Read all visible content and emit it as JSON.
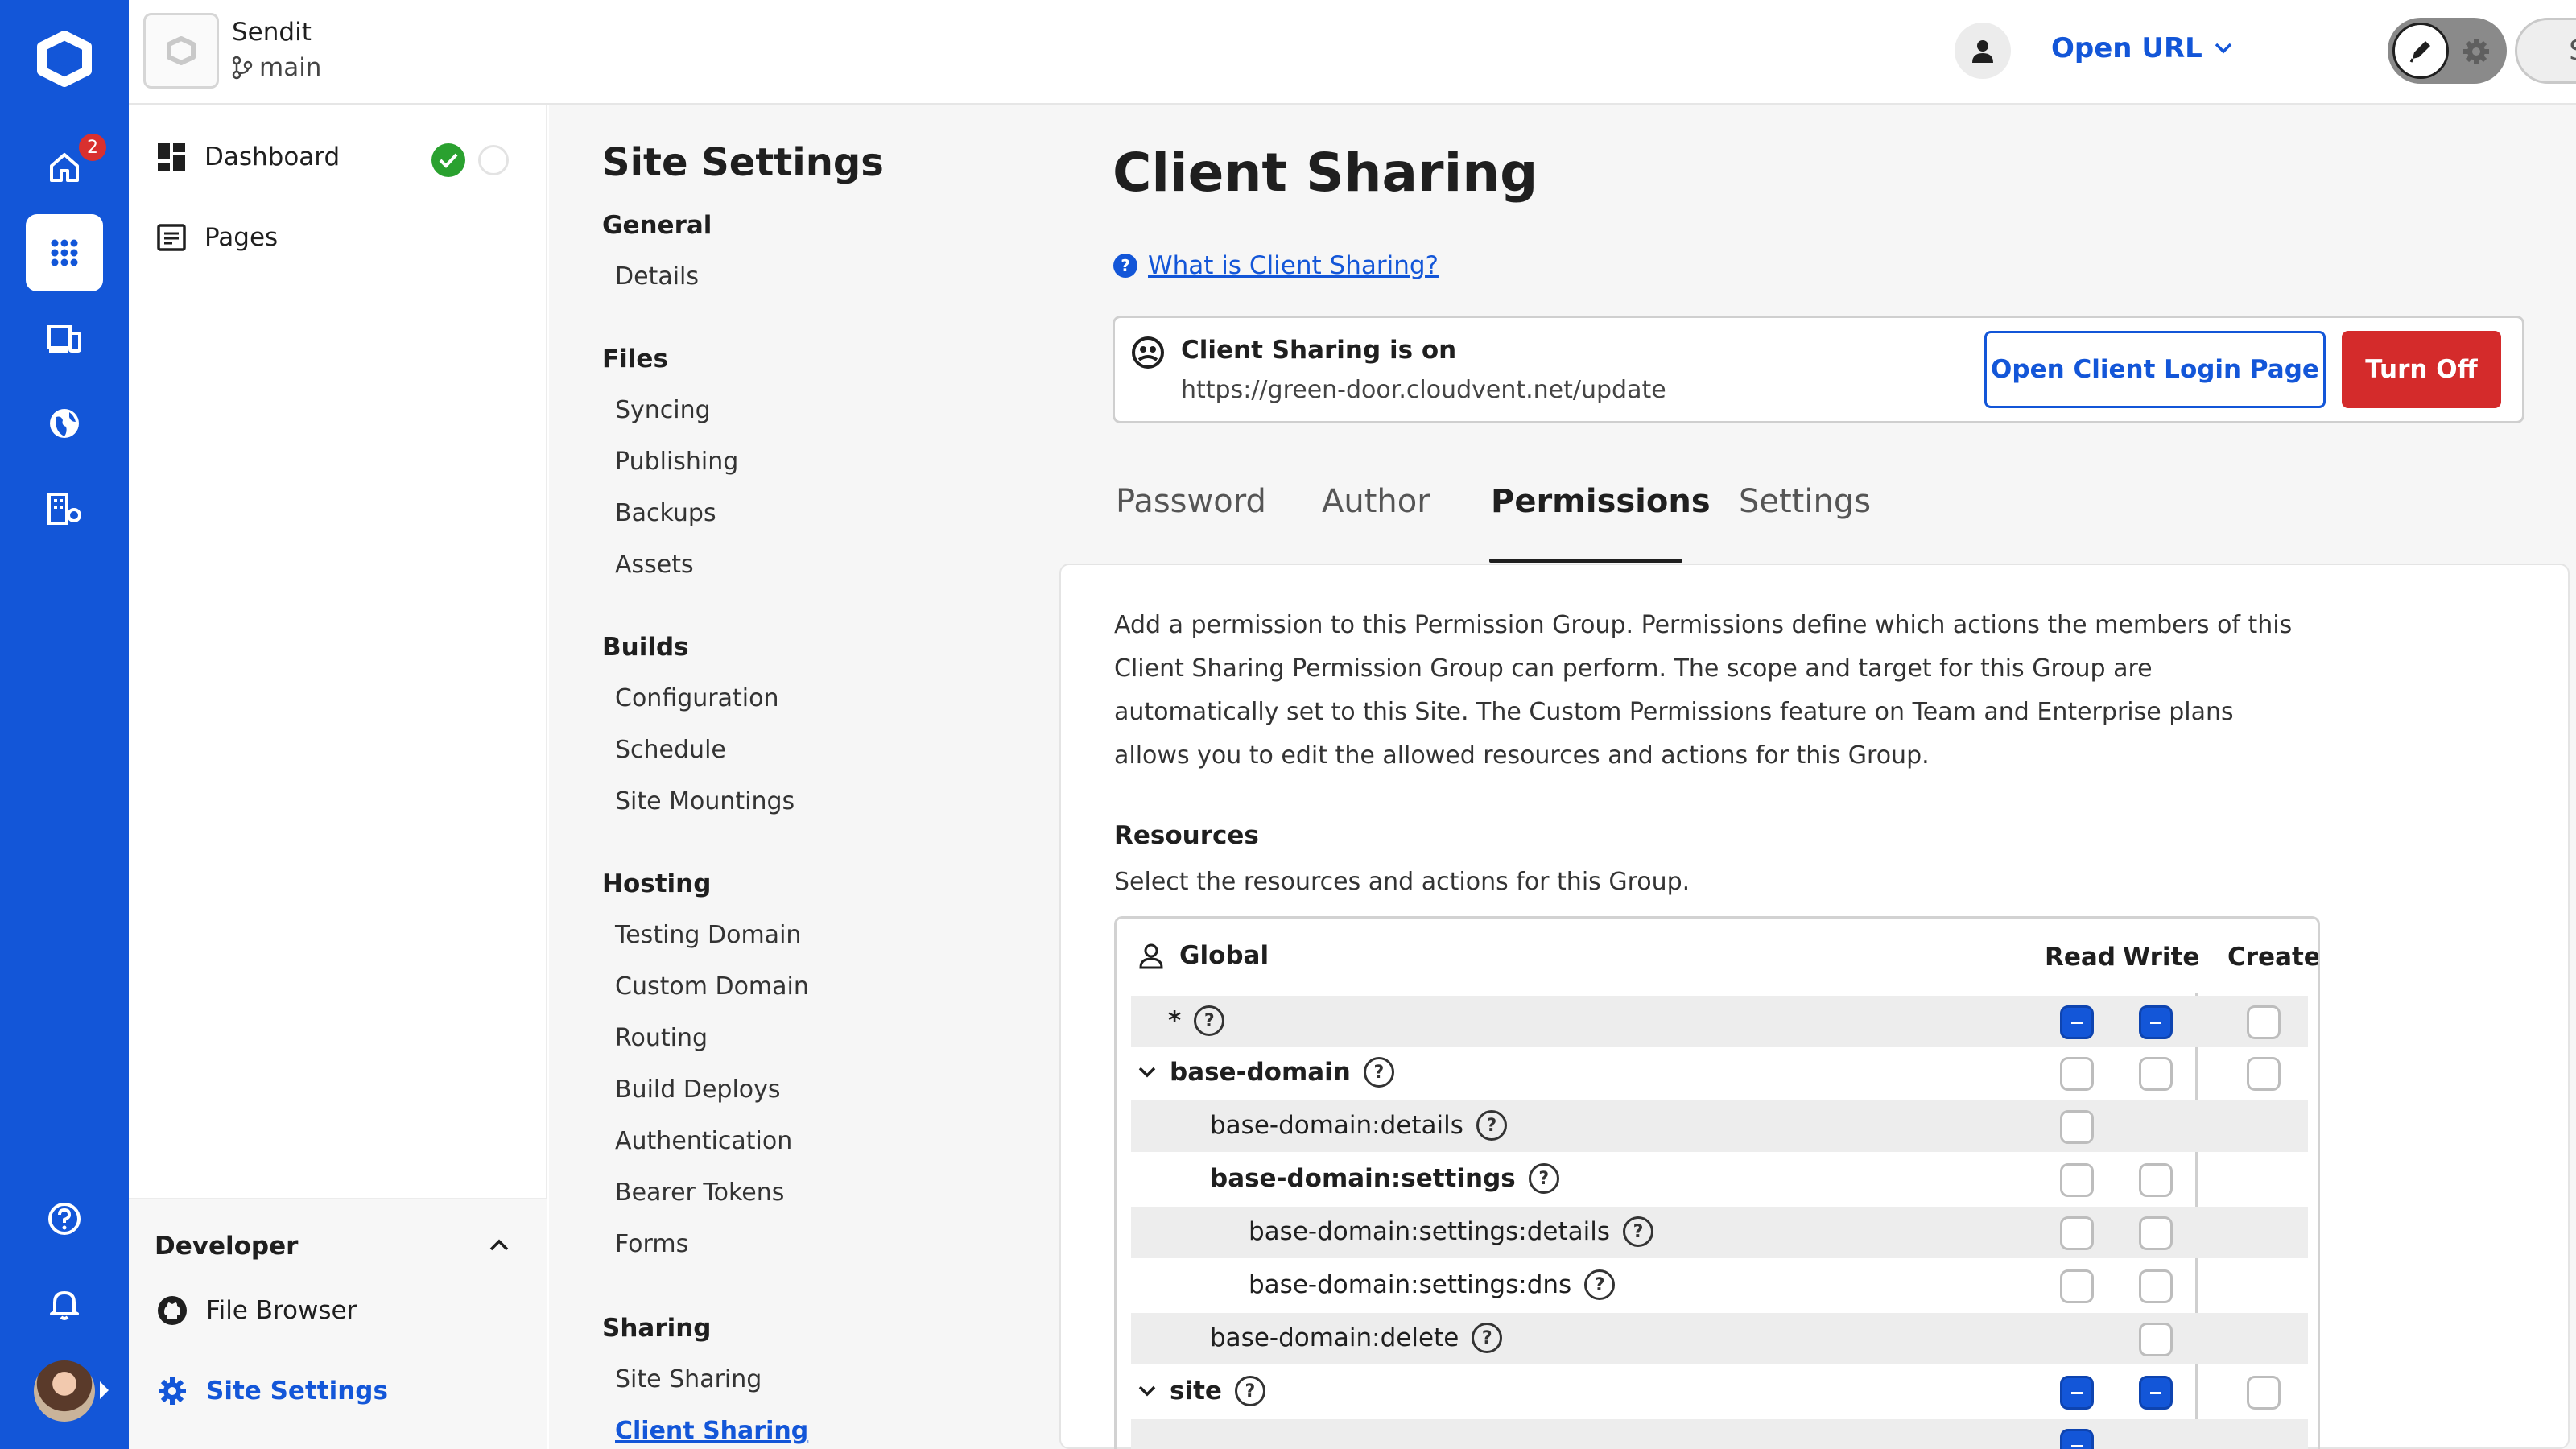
{
  "header": {
    "site_name": "Sendit",
    "branch": "main",
    "open_url": "Open URL",
    "save": "Save"
  },
  "rail": {
    "notification_count": "2"
  },
  "nav": {
    "dashboard": "Dashboard",
    "pages": "Pages",
    "developer": "Developer",
    "file_browser": "File Browser",
    "site_settings": "Site Settings"
  },
  "subnav": {
    "title": "Site Settings",
    "groups": [
      {
        "label": "General",
        "items": [
          "Details"
        ]
      },
      {
        "label": "Files",
        "items": [
          "Syncing",
          "Publishing",
          "Backups",
          "Assets"
        ]
      },
      {
        "label": "Builds",
        "items": [
          "Configuration",
          "Schedule",
          "Site Mountings"
        ]
      },
      {
        "label": "Hosting",
        "items": [
          "Testing Domain",
          "Custom Domain",
          "Routing",
          "Build Deploys",
          "Authentication",
          "Bearer Tokens",
          "Forms"
        ]
      },
      {
        "label": "Sharing",
        "items": [
          "Site Sharing",
          "Client Sharing"
        ]
      }
    ]
  },
  "main": {
    "title": "Client Sharing",
    "help_link": "What is Client Sharing?",
    "status_title": "Client Sharing is on",
    "status_url": "https://green-door.cloudvent.net/update",
    "open_login": "Open Client Login Page",
    "turn_off": "Turn Off",
    "tabs": [
      "Password",
      "Author",
      "Permissions",
      "Settings"
    ],
    "intro": "Add a permission to this Permission Group. Permissions define which actions the members of this Client Sharing Permission Group can perform. The scope and target for this Group are automatically set to this Site. The Custom Permissions feature on Team and Enterprise plans allows you to edit the allowed resources and actions for this Group.",
    "resources_title": "Resources",
    "resources_sub": "Select the resources and actions for this Group."
  },
  "permissions": {
    "scope": "Global",
    "columns": [
      "Read",
      "Write",
      "Create"
    ],
    "rows": [
      {
        "label": "*",
        "read": "mixed",
        "write": "mixed",
        "create": "empty"
      },
      {
        "label": "base-domain",
        "read": "empty",
        "write": "empty",
        "create": "empty"
      },
      {
        "label": "base-domain:details",
        "read": "empty"
      },
      {
        "label": "base-domain:settings",
        "read": "empty",
        "write": "empty"
      },
      {
        "label": "base-domain:settings:details",
        "read": "empty",
        "write": "empty"
      },
      {
        "label": "base-domain:settings:dns",
        "read": "empty",
        "write": "empty"
      },
      {
        "label": "base-domain:delete",
        "write": "empty"
      },
      {
        "label": "site",
        "read": "mixed",
        "write": "mixed",
        "create": "empty"
      }
    ]
  }
}
